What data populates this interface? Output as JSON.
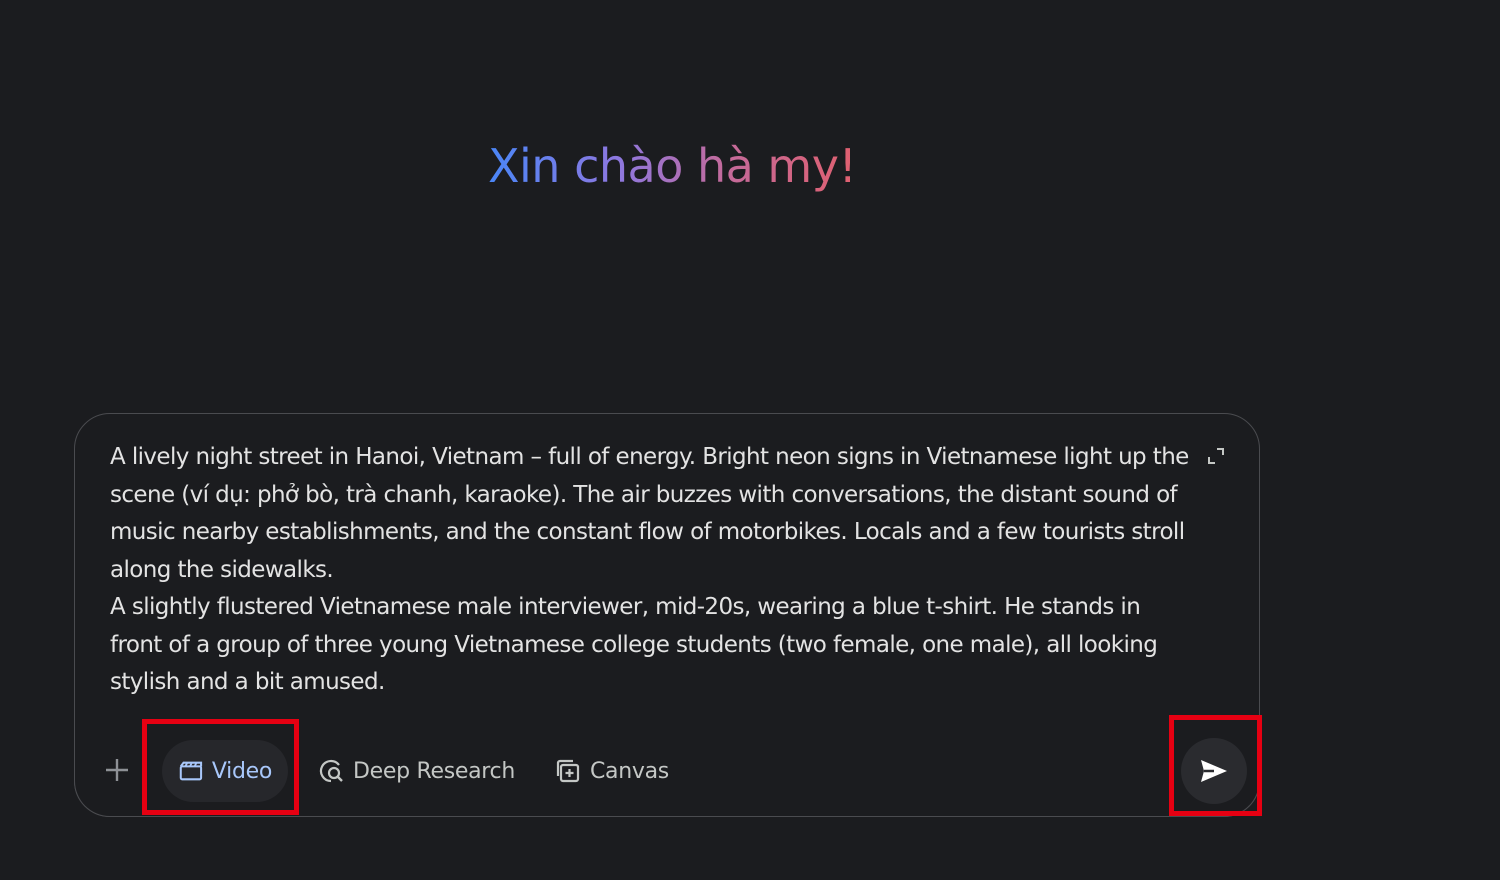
{
  "greeting": "Xin chào hà my!",
  "prompt": {
    "paragraphs": [
      "A lively night street in Hanoi, Vietnam – full of energy. Bright neon signs in Vietnamese light up the scene (ví dụ: phở bò, trà chanh, karaoke). The air buzzes with conversations, the distant sound of music nearby establishments, and the constant flow of motorbikes. Locals and a few tourists stroll along the sidewalks.",
      "A slightly flustered Vietnamese male interviewer, mid-20s, wearing a blue t-shirt. He stands in front of a group of three young Vietnamese college students (two female, one male), all looking stylish and a bit amused."
    ]
  },
  "toolbar": {
    "video_label": "Video",
    "deep_research_label": "Deep Research",
    "canvas_label": "Canvas"
  },
  "icons": {
    "plus": "plus-icon",
    "video": "clapperboard-icon",
    "deep_research": "deep-research-icon",
    "canvas": "canvas-icon",
    "expand": "expand-icon",
    "send": "send-icon"
  },
  "colors": {
    "background": "#1b1c1f",
    "text": "#e3e3e3",
    "chip_active_text": "#a8c7fa",
    "highlight": "#e60012",
    "gradient": [
      "#4a86f7",
      "#8d78e0",
      "#c46a9a",
      "#e0606f"
    ]
  }
}
